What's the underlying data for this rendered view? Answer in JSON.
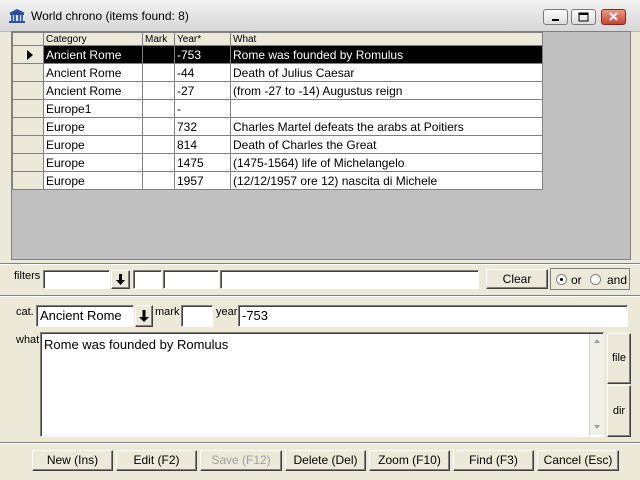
{
  "window": {
    "title": "World chrono (items found: 8)"
  },
  "grid": {
    "columns": [
      "Category",
      "Mark",
      "Year*",
      "What"
    ],
    "rows": [
      {
        "category": "Ancient Rome",
        "mark": "",
        "year": "-753",
        "what": "Rome was founded by Romulus",
        "selected": true
      },
      {
        "category": "Ancient Rome",
        "mark": "",
        "year": "-44",
        "what": "Death of Julius Caesar"
      },
      {
        "category": "Ancient Rome",
        "mark": "",
        "year": "-27",
        "what": "(from -27 to -14) Augustus reign"
      },
      {
        "category": "Europe1",
        "mark": "",
        "year": "-",
        "what": ""
      },
      {
        "category": "Europe",
        "mark": "",
        "year": "732",
        "what": "Charles Martel defeats the arabs at Poitiers"
      },
      {
        "category": "Europe",
        "mark": "",
        "year": "814",
        "what": "Death of Charles the Great"
      },
      {
        "category": "Europe",
        "mark": "",
        "year": "1475",
        "what": "(1475-1564) life of Michelangelo"
      },
      {
        "category": "Europe",
        "mark": "",
        "year": "1957",
        "what": "(12/12/1957 ore 12) nascita di Michele"
      }
    ]
  },
  "filters": {
    "label": "filters",
    "category_value": "",
    "mark_value": "",
    "year_value": "",
    "what_value": "",
    "clear_label": "Clear",
    "or_label": "or",
    "and_label": "and",
    "mode": "or"
  },
  "editor": {
    "cat_label": "cat.",
    "cat_value": "Ancient Rome",
    "mark_label": "mark",
    "mark_value": "",
    "year_label": "year",
    "year_value": "-753",
    "what_label": "what",
    "what_value": "Rome was founded by Romulus",
    "file_label": "file",
    "dir_label": "dir"
  },
  "buttons": {
    "new": "New (Ins)",
    "edit": "Edit (F2)",
    "save": "Save (F12)",
    "delete": "Delete (Del)",
    "zoom": "Zoom (F10)",
    "find": "Find (F3)",
    "cancel": "Cancel (Esc)"
  },
  "icons": {
    "app": "temple-icon",
    "minimize": "minimize-icon",
    "maximize": "maximize-icon",
    "close": "close-icon",
    "dropdown": "dropdown-arrow-icon",
    "row_pointer": "row-pointer-icon"
  }
}
